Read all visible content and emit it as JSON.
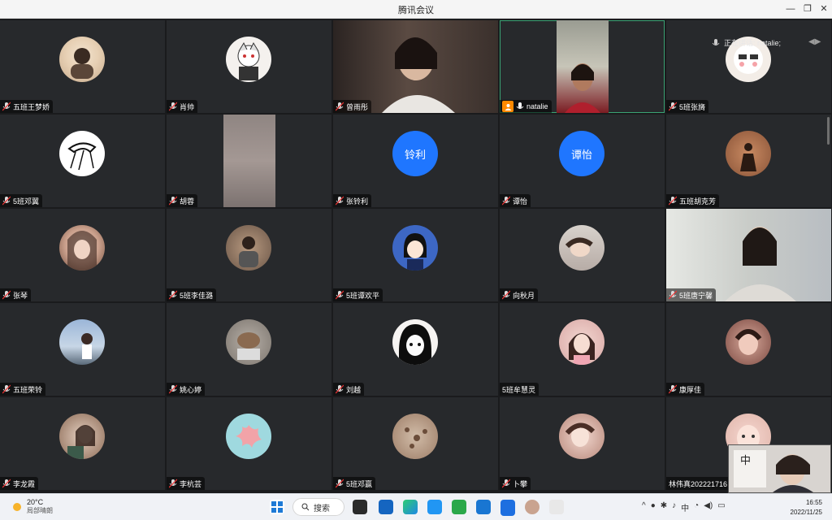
{
  "window": {
    "title": "腾讯会议"
  },
  "speaking": {
    "label": "正在讲话: natalie;"
  },
  "participants": [
    "五班王梦娇",
    "肖帅",
    "曾雨彤",
    "natalie",
    "5班张旖",
    "5班邓翼",
    "胡蓉",
    "张铃利",
    "谭怡",
    "五班胡克芳",
    "张琴",
    "5班李佳潞",
    "5班谭欢平",
    "向秋月",
    "5班唐宁馨",
    "五班荣铃",
    "姚心婷",
    "刘越",
    "5班牟慧灵",
    "康厚佳",
    "李龙霞",
    "李杭芸",
    "5班邓赢",
    "卜攀",
    "林伟真202221716"
  ],
  "avatar_text": {
    "zhanglingli": "铃利",
    "tanyi": "谭怡"
  },
  "selfview": {
    "badge": "中"
  },
  "taskbar": {
    "weather_temp": "20°C",
    "weather_desc": "局部晴朗",
    "search_label": "搜索",
    "time": "16:55",
    "date": "2022/11/25",
    "tray_lang": "中"
  },
  "colors": {
    "accent_blue": "#1f76ff",
    "speaking_green": "#3aa374",
    "host_orange": "#ff8a00"
  }
}
